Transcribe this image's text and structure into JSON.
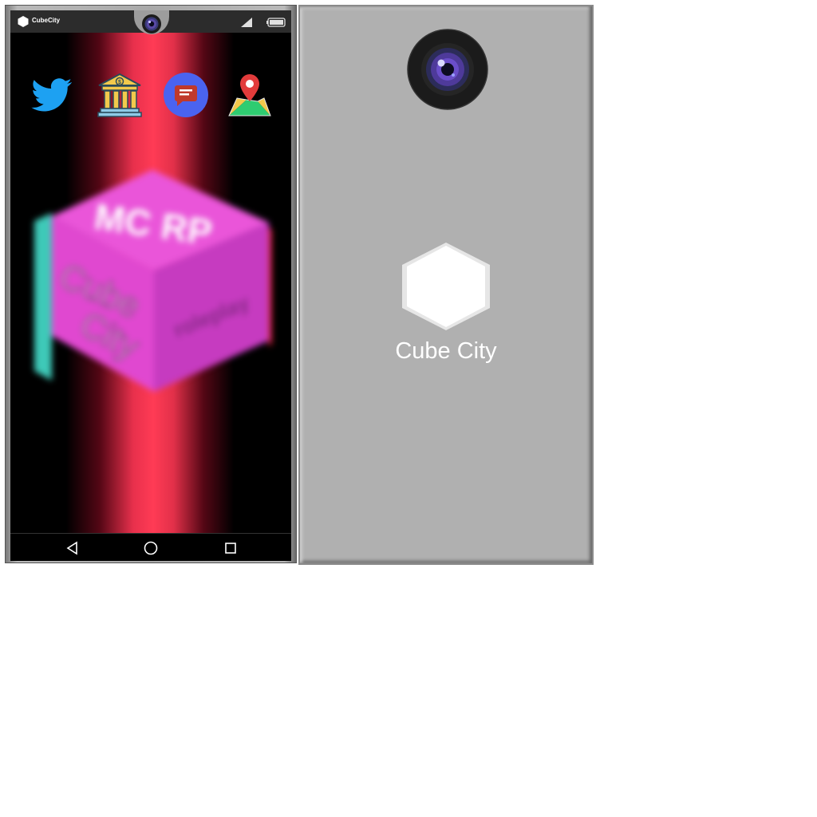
{
  "status_bar": {
    "app_name": "CubeCity"
  },
  "home_icons": [
    {
      "name": "twitter-icon",
      "color": "#1da1f2"
    },
    {
      "name": "bank-icon",
      "color": "#f2c94c"
    },
    {
      "name": "messages-icon",
      "color": "#4a63f0"
    },
    {
      "name": "maps-icon",
      "color": "#e23b3b"
    }
  ],
  "wallpaper": {
    "cube_text": {
      "top": "MC RP",
      "left_line1": "Cube",
      "left_line2": "City",
      "right": "roleplay"
    },
    "cube_color": "#e048d0",
    "beam_color": "#ff3b55"
  },
  "nav_bar": {
    "back": "back-icon",
    "home": "home-icon",
    "recents": "recents-icon"
  },
  "back_panel": {
    "brand": "Cube City"
  }
}
